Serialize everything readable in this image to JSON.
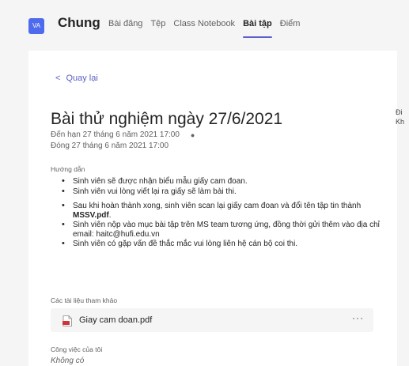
{
  "header": {
    "team_avatar": "VA",
    "channel_name": "Chung",
    "tabs": [
      {
        "label": "Bài đăng"
      },
      {
        "label": "Tệp"
      },
      {
        "label": "Class Notebook"
      },
      {
        "label": "Bài tập"
      },
      {
        "label": "Điểm"
      }
    ],
    "active_tab": "Bài tập"
  },
  "assignment": {
    "back_label": "Quay lại",
    "title": "Bài thử nghiệm ngày 27/6/2021",
    "due": "Đến hạn 27 tháng 6 năm 2021 17:00",
    "closes": "Đóng 27 tháng 6 năm 2021 17:00",
    "instructions_label": "Hướng dẫn",
    "instructions": [
      "Sinh viên sẽ được nhận biểu mẫu giấy cam đoan.",
      "Sinh viên vui lòng viết lại ra giấy sẽ làm bài thi.",
      "Sau khi hoàn thành xong, sinh viên scan lại giấy cam đoan và đổi tên tập tin thành ",
      "Sinh viên nộp vào mục bài tập trên MS team tương ứng, đồng thời gửi thêm vào địa chỉ email: haitc@hufi.edu.vn",
      "Sinh viên có gặp vấn đề thắc mắc vui lòng liên hệ cán bộ coi thi."
    ],
    "instruction_bold": "MSSV.pdf",
    "instruction_bold_suffix": ".",
    "references_label": "Các tài liệu tham khảo",
    "file_name": "Giay cam doan.pdf",
    "file_more": "···",
    "my_work_label": "Công việc của tôi",
    "my_work_value": "Không có"
  },
  "side_panel": {
    "line1": "Đi",
    "line2": "Kh"
  },
  "colors": {
    "accent": "#5b5fc7",
    "avatar_bg": "#4f6bed",
    "page_bg": "#f5f5f5",
    "card_bg": "#ffffff",
    "pdf_icon": "#d13438"
  },
  "icons": {
    "back": "chevron-left-icon",
    "file": "pdf-file-icon",
    "more": "more-options-icon"
  }
}
